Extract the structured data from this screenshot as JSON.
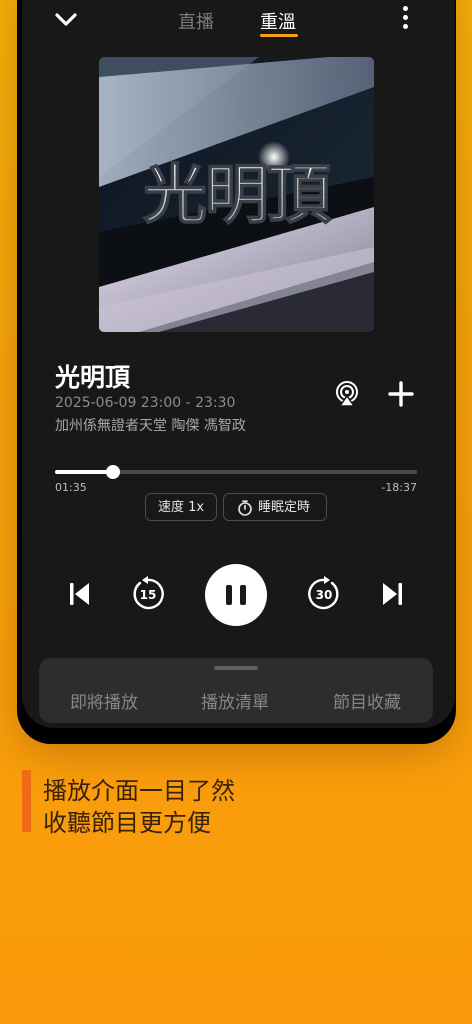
{
  "header": {
    "tabs": [
      {
        "label": "直播",
        "active": false
      },
      {
        "label": "重溫",
        "active": true
      }
    ]
  },
  "program": {
    "title": "光明頂",
    "artwork_text": "光明頂",
    "datetime": "2025-06-09 23:00 - 23:30",
    "hosts": "加州係無證者天堂 陶傑 馮智政"
  },
  "progress": {
    "elapsed": "01:35",
    "remaining": "-18:37",
    "fraction": 0.159
  },
  "options": {
    "speed_label": "速度 1x",
    "sleep_timer_label": "睡眠定時"
  },
  "controls": {
    "rewind_seconds": "15",
    "forward_seconds": "30",
    "state": "playing"
  },
  "bottom_sheet": {
    "tabs": [
      "即將播放",
      "播放清單",
      "節目收藏"
    ]
  },
  "promo": {
    "line1": "播放介面一目了然",
    "line2": "收聽節目更方便"
  },
  "colors": {
    "accent": "#f6a017",
    "background_orange": "#f7a30c",
    "promo_bar": "#ee6a14"
  }
}
